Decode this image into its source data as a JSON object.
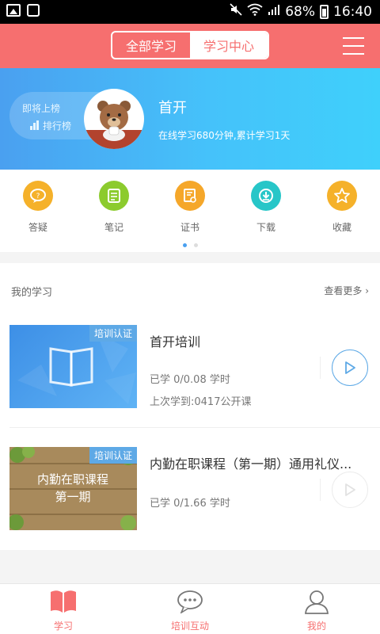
{
  "status_bar": {
    "battery": "68%",
    "time": "16:40"
  },
  "header": {
    "tabs": [
      {
        "label": "全部学习",
        "active": false
      },
      {
        "label": "学习中心",
        "active": true
      }
    ],
    "accent_color": "#f66f6f"
  },
  "banner": {
    "rank_label": "即将上榜",
    "leaderboard_link": "排行榜",
    "username": "首开",
    "study_summary": "在线学习680分钟,累计学习1天"
  },
  "quick_actions": [
    {
      "label": "答疑",
      "icon": "chat-bubble-icon",
      "color": "#f5b12a"
    },
    {
      "label": "笔记",
      "icon": "note-icon",
      "color": "#8ccb2e"
    },
    {
      "label": "证书",
      "icon": "certificate-icon",
      "color": "#f5a72a"
    },
    {
      "label": "下载",
      "icon": "download-icon",
      "color": "#27c6c8"
    },
    {
      "label": "收藏",
      "icon": "star-icon",
      "color": "#f5b12a"
    }
  ],
  "my_learning": {
    "title": "我的学习",
    "see_more": "查看更多",
    "courses": [
      {
        "tag": "培训认证",
        "title": "首开培训",
        "progress": "已学 0/0.08 学时",
        "last_studied": "上次学到:0417公开课"
      },
      {
        "tag": "培训认证",
        "title": "内勤在职课程（第一期）通用礼仪...",
        "thumb_text_line1": "内勤在职课程",
        "thumb_text_line2": "第一期",
        "progress": "已学 0/1.66 学时"
      }
    ]
  },
  "bottom_nav": [
    {
      "label": "学习",
      "icon": "book-icon",
      "active": true
    },
    {
      "label": "培训互动",
      "icon": "chat-icon",
      "active": false
    },
    {
      "label": "我的",
      "icon": "person-icon",
      "active": false
    }
  ]
}
